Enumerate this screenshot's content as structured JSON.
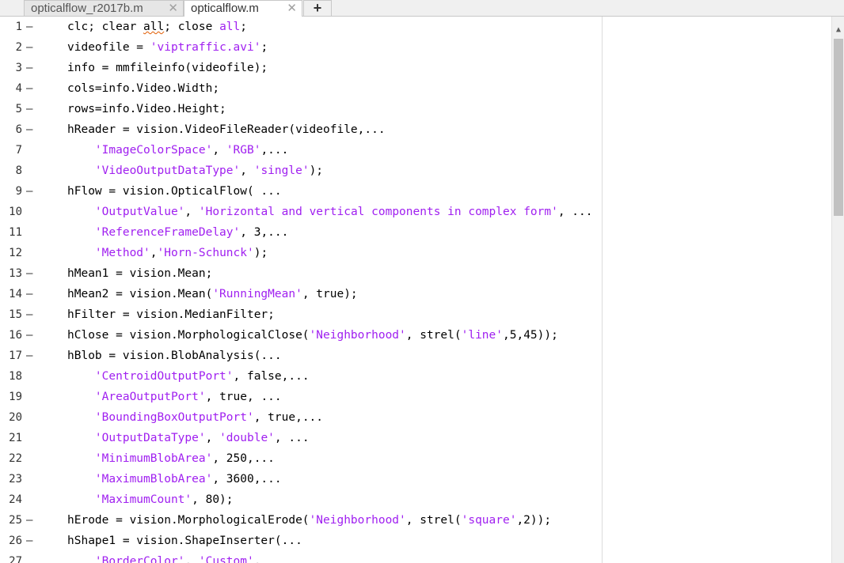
{
  "tabs": [
    {
      "label": "opticalflow_r2017b.m",
      "close": "✕"
    },
    {
      "label": "opticalflow.m",
      "close": "✕"
    }
  ],
  "add_tab_label": "+",
  "scroll_up_glyph": "▲",
  "lines": [
    {
      "num": "1",
      "dash": "—",
      "segs": [
        {
          "t": "clc; clear "
        },
        {
          "t": "all",
          "c": "warn"
        },
        {
          "t": "; close "
        },
        {
          "t": "all",
          "c": "str"
        },
        {
          "t": ";"
        }
      ]
    },
    {
      "num": "2",
      "dash": "—",
      "segs": [
        {
          "t": "videofile = "
        },
        {
          "t": "'viptraffic.avi'",
          "c": "str"
        },
        {
          "t": ";"
        }
      ]
    },
    {
      "num": "3",
      "dash": "—",
      "segs": [
        {
          "t": "info = mmfileinfo(videofile);"
        }
      ]
    },
    {
      "num": "4",
      "dash": "—",
      "segs": [
        {
          "t": "cols=info.Video.Width;"
        }
      ]
    },
    {
      "num": "5",
      "dash": "—",
      "segs": [
        {
          "t": "rows=info.Video.Height;"
        }
      ]
    },
    {
      "num": "6",
      "dash": "—",
      "segs": [
        {
          "t": "hReader = vision.VideoFileReader(videofile,..."
        }
      ]
    },
    {
      "num": "7",
      "dash": "",
      "segs": [
        {
          "t": "    "
        },
        {
          "t": "'ImageColorSpace'",
          "c": "str"
        },
        {
          "t": ", "
        },
        {
          "t": "'RGB'",
          "c": "str"
        },
        {
          "t": ",..."
        }
      ]
    },
    {
      "num": "8",
      "dash": "",
      "segs": [
        {
          "t": "    "
        },
        {
          "t": "'VideoOutputDataType'",
          "c": "str"
        },
        {
          "t": ", "
        },
        {
          "t": "'single'",
          "c": "str"
        },
        {
          "t": ");"
        }
      ]
    },
    {
      "num": "9",
      "dash": "—",
      "segs": [
        {
          "t": "hFlow = vision.OpticalFlow( ..."
        }
      ]
    },
    {
      "num": "10",
      "dash": "",
      "segs": [
        {
          "t": "    "
        },
        {
          "t": "'OutputValue'",
          "c": "str"
        },
        {
          "t": ", "
        },
        {
          "t": "'Horizontal and vertical components in complex form'",
          "c": "str"
        },
        {
          "t": ", ..."
        }
      ]
    },
    {
      "num": "11",
      "dash": "",
      "segs": [
        {
          "t": "    "
        },
        {
          "t": "'ReferenceFrameDelay'",
          "c": "str"
        },
        {
          "t": ", 3,..."
        }
      ]
    },
    {
      "num": "12",
      "dash": "",
      "segs": [
        {
          "t": "    "
        },
        {
          "t": "'Method'",
          "c": "str"
        },
        {
          "t": ","
        },
        {
          "t": "'Horn-Schunck'",
          "c": "str"
        },
        {
          "t": ");"
        }
      ]
    },
    {
      "num": "13",
      "dash": "—",
      "segs": [
        {
          "t": "hMean1 = vision.Mean;"
        }
      ]
    },
    {
      "num": "14",
      "dash": "—",
      "segs": [
        {
          "t": "hMean2 = vision.Mean("
        },
        {
          "t": "'RunningMean'",
          "c": "str"
        },
        {
          "t": ", true);"
        }
      ]
    },
    {
      "num": "15",
      "dash": "—",
      "segs": [
        {
          "t": "hFilter = vision.MedianFilter;"
        }
      ]
    },
    {
      "num": "16",
      "dash": "—",
      "segs": [
        {
          "t": "hClose = vision.MorphologicalClose("
        },
        {
          "t": "'Neighborhood'",
          "c": "str"
        },
        {
          "t": ", strel("
        },
        {
          "t": "'line'",
          "c": "str"
        },
        {
          "t": ",5,45));"
        }
      ]
    },
    {
      "num": "17",
      "dash": "—",
      "segs": [
        {
          "t": "hBlob = vision.BlobAnalysis(..."
        }
      ]
    },
    {
      "num": "18",
      "dash": "",
      "segs": [
        {
          "t": "    "
        },
        {
          "t": "'CentroidOutputPort'",
          "c": "str"
        },
        {
          "t": ", false,..."
        }
      ]
    },
    {
      "num": "19",
      "dash": "",
      "segs": [
        {
          "t": "    "
        },
        {
          "t": "'AreaOutputPort'",
          "c": "str"
        },
        {
          "t": ", true, ..."
        }
      ]
    },
    {
      "num": "20",
      "dash": "",
      "segs": [
        {
          "t": "    "
        },
        {
          "t": "'BoundingBoxOutputPort'",
          "c": "str"
        },
        {
          "t": ", true,..."
        }
      ]
    },
    {
      "num": "21",
      "dash": "",
      "segs": [
        {
          "t": "    "
        },
        {
          "t": "'OutputDataType'",
          "c": "str"
        },
        {
          "t": ", "
        },
        {
          "t": "'double'",
          "c": "str"
        },
        {
          "t": ", ..."
        }
      ]
    },
    {
      "num": "22",
      "dash": "",
      "segs": [
        {
          "t": "    "
        },
        {
          "t": "'MinimumBlobArea'",
          "c": "str"
        },
        {
          "t": ", 250,..."
        }
      ]
    },
    {
      "num": "23",
      "dash": "",
      "segs": [
        {
          "t": "    "
        },
        {
          "t": "'MaximumBlobArea'",
          "c": "str"
        },
        {
          "t": ", 3600,..."
        }
      ]
    },
    {
      "num": "24",
      "dash": "",
      "segs": [
        {
          "t": "    "
        },
        {
          "t": "'MaximumCount'",
          "c": "str"
        },
        {
          "t": ", 80);"
        }
      ]
    },
    {
      "num": "25",
      "dash": "—",
      "segs": [
        {
          "t": "hErode = vision.MorphologicalErode("
        },
        {
          "t": "'Neighborhood'",
          "c": "str"
        },
        {
          "t": ", strel("
        },
        {
          "t": "'square'",
          "c": "str"
        },
        {
          "t": ",2));"
        }
      ]
    },
    {
      "num": "26",
      "dash": "—",
      "segs": [
        {
          "t": "hShape1 = vision.ShapeInserter(..."
        }
      ]
    },
    {
      "num": "27",
      "dash": "",
      "segs": [
        {
          "t": "    "
        },
        {
          "t": "'BorderColor'",
          "c": "str"
        },
        {
          "t": ", "
        },
        {
          "t": "'Custom'",
          "c": "str"
        },
        {
          "t": ","
        }
      ]
    }
  ]
}
